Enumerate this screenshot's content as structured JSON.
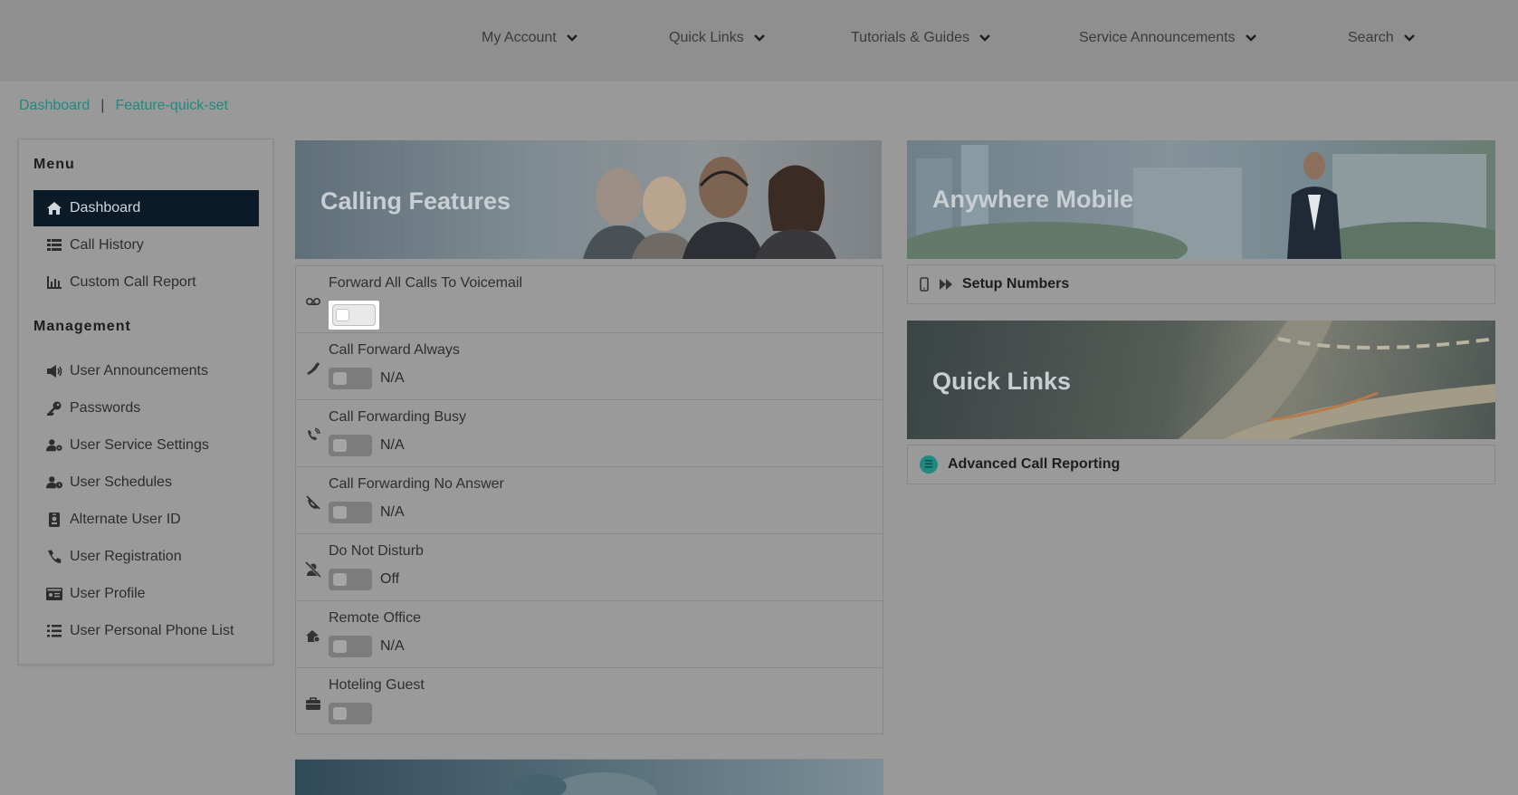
{
  "nav": {
    "items": [
      {
        "label": "My Account"
      },
      {
        "label": "Quick Links"
      },
      {
        "label": "Tutorials & Guides"
      },
      {
        "label": "Service Announcements"
      },
      {
        "label": "Search"
      }
    ]
  },
  "breadcrumb": {
    "home": "Dashboard",
    "separator": "|",
    "current": "Feature-quick-set"
  },
  "sidebar": {
    "menu_heading": "Menu",
    "menu_items": [
      {
        "label": "Dashboard",
        "icon": "home-icon"
      },
      {
        "label": "Call History",
        "icon": "list-icon"
      },
      {
        "label": "Custom Call Report",
        "icon": "bar-chart-icon"
      }
    ],
    "management_heading": "Management",
    "management_items": [
      {
        "label": "User Announcements",
        "icon": "megaphone-icon"
      },
      {
        "label": "Passwords",
        "icon": "key-icon"
      },
      {
        "label": "User Service Settings",
        "icon": "user-gear-icon"
      },
      {
        "label": "User Schedules",
        "icon": "user-clock-icon"
      },
      {
        "label": "Alternate User ID",
        "icon": "id-badge-icon"
      },
      {
        "label": "User Registration",
        "icon": "phone-icon"
      },
      {
        "label": "User Profile",
        "icon": "id-card-icon"
      },
      {
        "label": "User Personal Phone List",
        "icon": "list-icon"
      }
    ]
  },
  "calling_features": {
    "title": "Calling Features",
    "features": [
      {
        "label": "Forward All Calls To Voicemail",
        "status": "",
        "icon": "voicemail-icon"
      },
      {
        "label": "Call Forward Always",
        "status": "N/A",
        "icon": "phone-icon"
      },
      {
        "label": "Call Forwarding Busy",
        "status": "N/A",
        "icon": "phone-volume-icon"
      },
      {
        "label": "Call Forwarding No Answer",
        "status": "N/A",
        "icon": "phone-slash-icon"
      },
      {
        "label": "Do Not Disturb",
        "status": "Off",
        "icon": "user-slash-icon"
      },
      {
        "label": "Remote Office",
        "status": "N/A",
        "icon": "house-user-icon"
      },
      {
        "label": "Hoteling Guest",
        "status": "",
        "icon": "briefcase-icon"
      }
    ]
  },
  "anywhere_mobile": {
    "title": "Anywhere Mobile",
    "link": "Setup Numbers"
  },
  "quick_links": {
    "title": "Quick Links",
    "link": "Advanced Call Reporting"
  },
  "colors": {
    "accent": "#1f8a80",
    "active_menu": "#0a1a26",
    "overlay": "#999999"
  }
}
